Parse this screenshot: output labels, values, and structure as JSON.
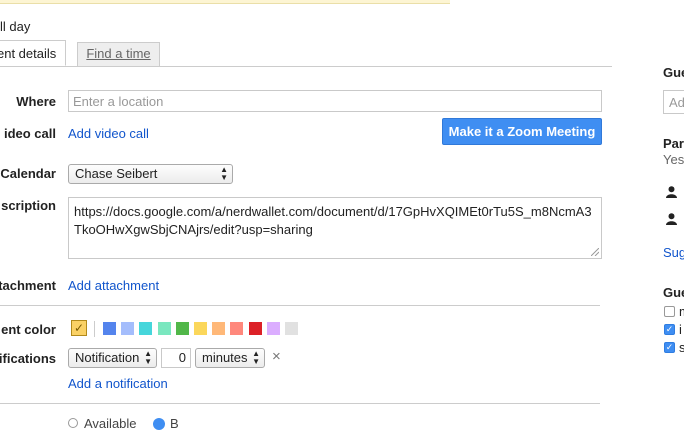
{
  "all_day_label": "ll day",
  "tabs": {
    "event_details": "ent details",
    "find_a_time": "Find a time"
  },
  "where": {
    "label": "Where",
    "placeholder": "Enter a location"
  },
  "video_call": {
    "label": "ideo call",
    "link": "Add video call"
  },
  "zoom_button": "Make it a Zoom Meeting",
  "calendar": {
    "label": "Calendar",
    "value": "Chase Seibert"
  },
  "description": {
    "label": "scription",
    "value": "https://docs.google.com/a/nerdwallet.com/document/d/17GpHvXQIMEt0rTu5S_m8NcmA3TkoOHwXgwSbjCNAjrs/edit?usp=sharing"
  },
  "attachment": {
    "label": "ttachment",
    "link": "Add attachment"
  },
  "event_color": {
    "label": "ent color",
    "selected": "#fad165",
    "swatches": [
      "#5484ed",
      "#a4bdfc",
      "#46d6db",
      "#7ae7bf",
      "#51b749",
      "#fbd75b",
      "#ffb878",
      "#ff887c",
      "#dc2127",
      "#dbadff",
      "#e1e1e1"
    ]
  },
  "notifications": {
    "label": "tifications",
    "type": "Notification",
    "amount": "0",
    "unit": "minutes",
    "remove": "×",
    "add_link": "Add a notification"
  },
  "right_panel": {
    "guests_label": "Gue",
    "add_guests_placeholder": "Ad",
    "party_label": "Par",
    "yes_text": "Yes",
    "suggest_link": "Sug",
    "guests_can_label": "Gue",
    "options": [
      {
        "text": "m",
        "checked": false
      },
      {
        "text": "i",
        "checked": true
      },
      {
        "text": "s",
        "checked": true
      }
    ]
  },
  "bottom": {
    "available": "Available",
    "busy": "B"
  }
}
